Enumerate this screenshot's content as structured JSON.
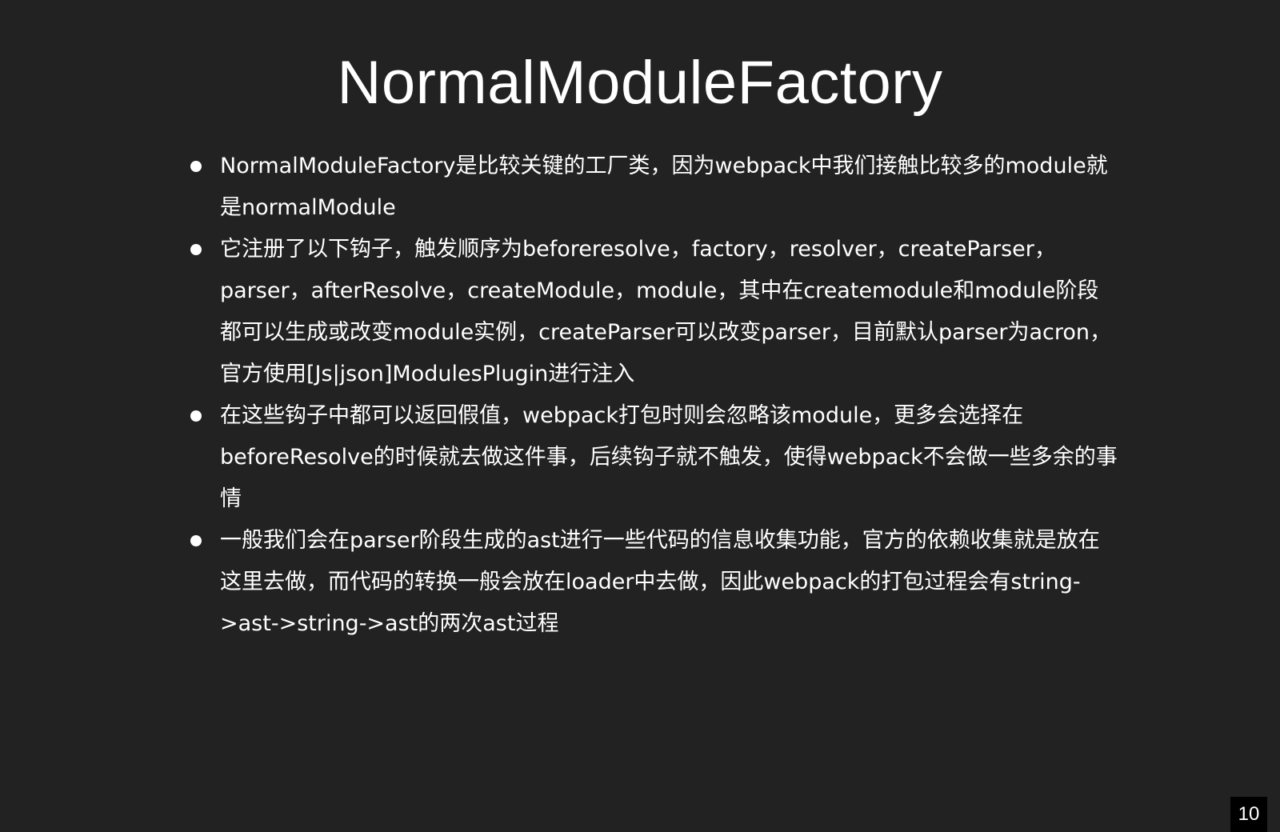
{
  "slide": {
    "title": "NormalModuleFactory",
    "bullets": [
      {
        "text": "NormalModuleFactory是比较关键的工厂类，因为webpack中我们接触比较多的module就是normalModule"
      },
      {
        "text": "它注册了以下钩子，触发顺序为beforeresolve，factory，resolver，createParser，parser，afterResolve，createModule，module，其中在createmodule和module阶段都可以生成或改变module实例，createParser可以改变parser，目前默认parser为acron，官方使用[Js|json]ModulesPlugin进行注入"
      },
      {
        "text": "在这些钩子中都可以返回假值，webpack打包时则会忽略该module，更多会选择在beforeResolve的时候就去做这件事，后续钩子就不触发，使得webpack不会做一些多余的事情"
      },
      {
        "text": "一般我们会在parser阶段生成的ast进行一些代码的信息收集功能，官方的依赖收集就是放在这里去做，而代码的转换一般会放在loader中去做，因此webpack的打包过程会有string->ast->string->ast的两次ast过程"
      }
    ],
    "page_number": "10"
  },
  "colors": {
    "background": "#222222",
    "text": "#ffffff",
    "page_number_background": "#000000"
  }
}
